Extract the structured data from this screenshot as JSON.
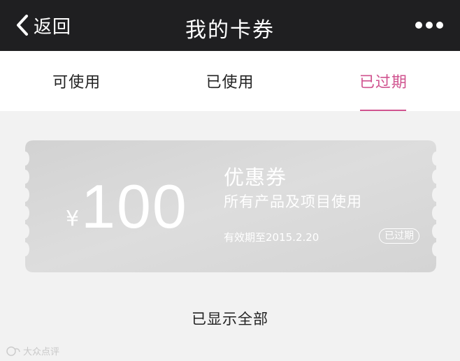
{
  "navbar": {
    "back_label": "返回",
    "title": "我的卡券"
  },
  "tabs": [
    {
      "label": "可使用",
      "active": false
    },
    {
      "label": "已使用",
      "active": false
    },
    {
      "label": "已过期",
      "active": true
    }
  ],
  "coupon": {
    "currency": "¥",
    "amount": "100",
    "title": "优惠券",
    "description": "所有产品及项目使用",
    "validity": "有效期至2015.2.20",
    "status_badge": "已过期"
  },
  "footer": {
    "text": "已显示全部"
  },
  "watermark": {
    "text": "大众点评"
  },
  "colors": {
    "navbar_bg": "#1f1f21",
    "accent": "#d0538f",
    "coupon_bg": "#d6d6d6",
    "page_bg": "#f2f2f2"
  },
  "icons": {
    "back": "chevron-left-icon",
    "more": "more-dots-icon",
    "watermark": "watermark-logo-icon"
  }
}
